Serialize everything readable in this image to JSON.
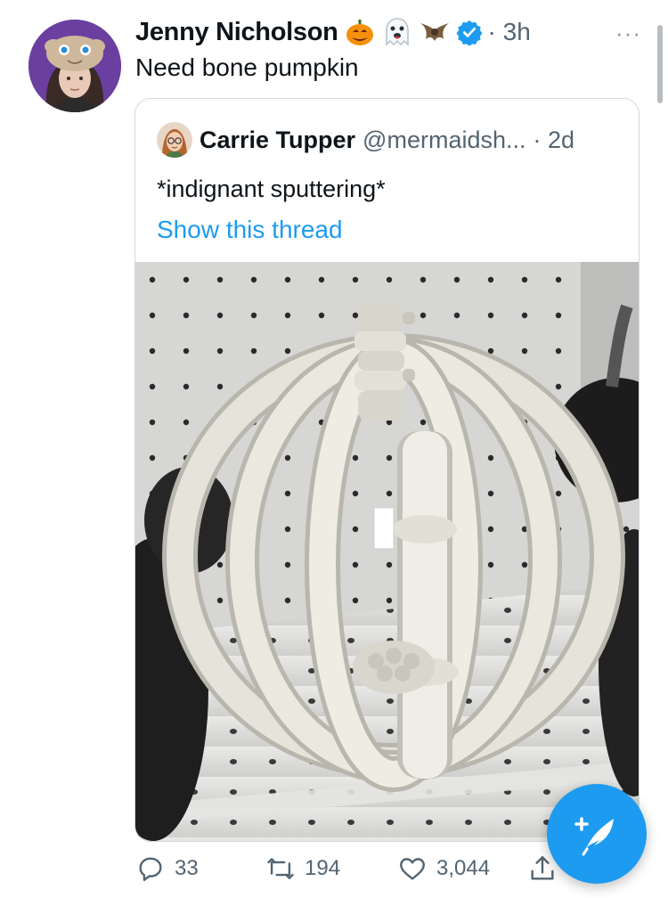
{
  "tweet": {
    "author_name": "Jenny Nicholson",
    "name_emojis": [
      "pumpkin-emoji",
      "ghost-emoji",
      "bat-emoji"
    ],
    "verified": true,
    "time": "· 3h",
    "more_label": "···",
    "text": "Need bone pumpkin"
  },
  "quote": {
    "author_name": "Carrie Tupper",
    "handle": "@mermaidsh...",
    "time": "· 2d",
    "text": "*indignant sputtering*",
    "show_thread": "Show this thread",
    "image_subject": "bone-pumpkin-photo"
  },
  "actions": {
    "reply_count": "33",
    "retweet_count": "194",
    "like_count": "3,044"
  },
  "colors": {
    "accent": "#1d9bf0",
    "secondary_text": "#536471",
    "border": "#cfd9de",
    "avatar_bg": "#6b3fa0"
  }
}
